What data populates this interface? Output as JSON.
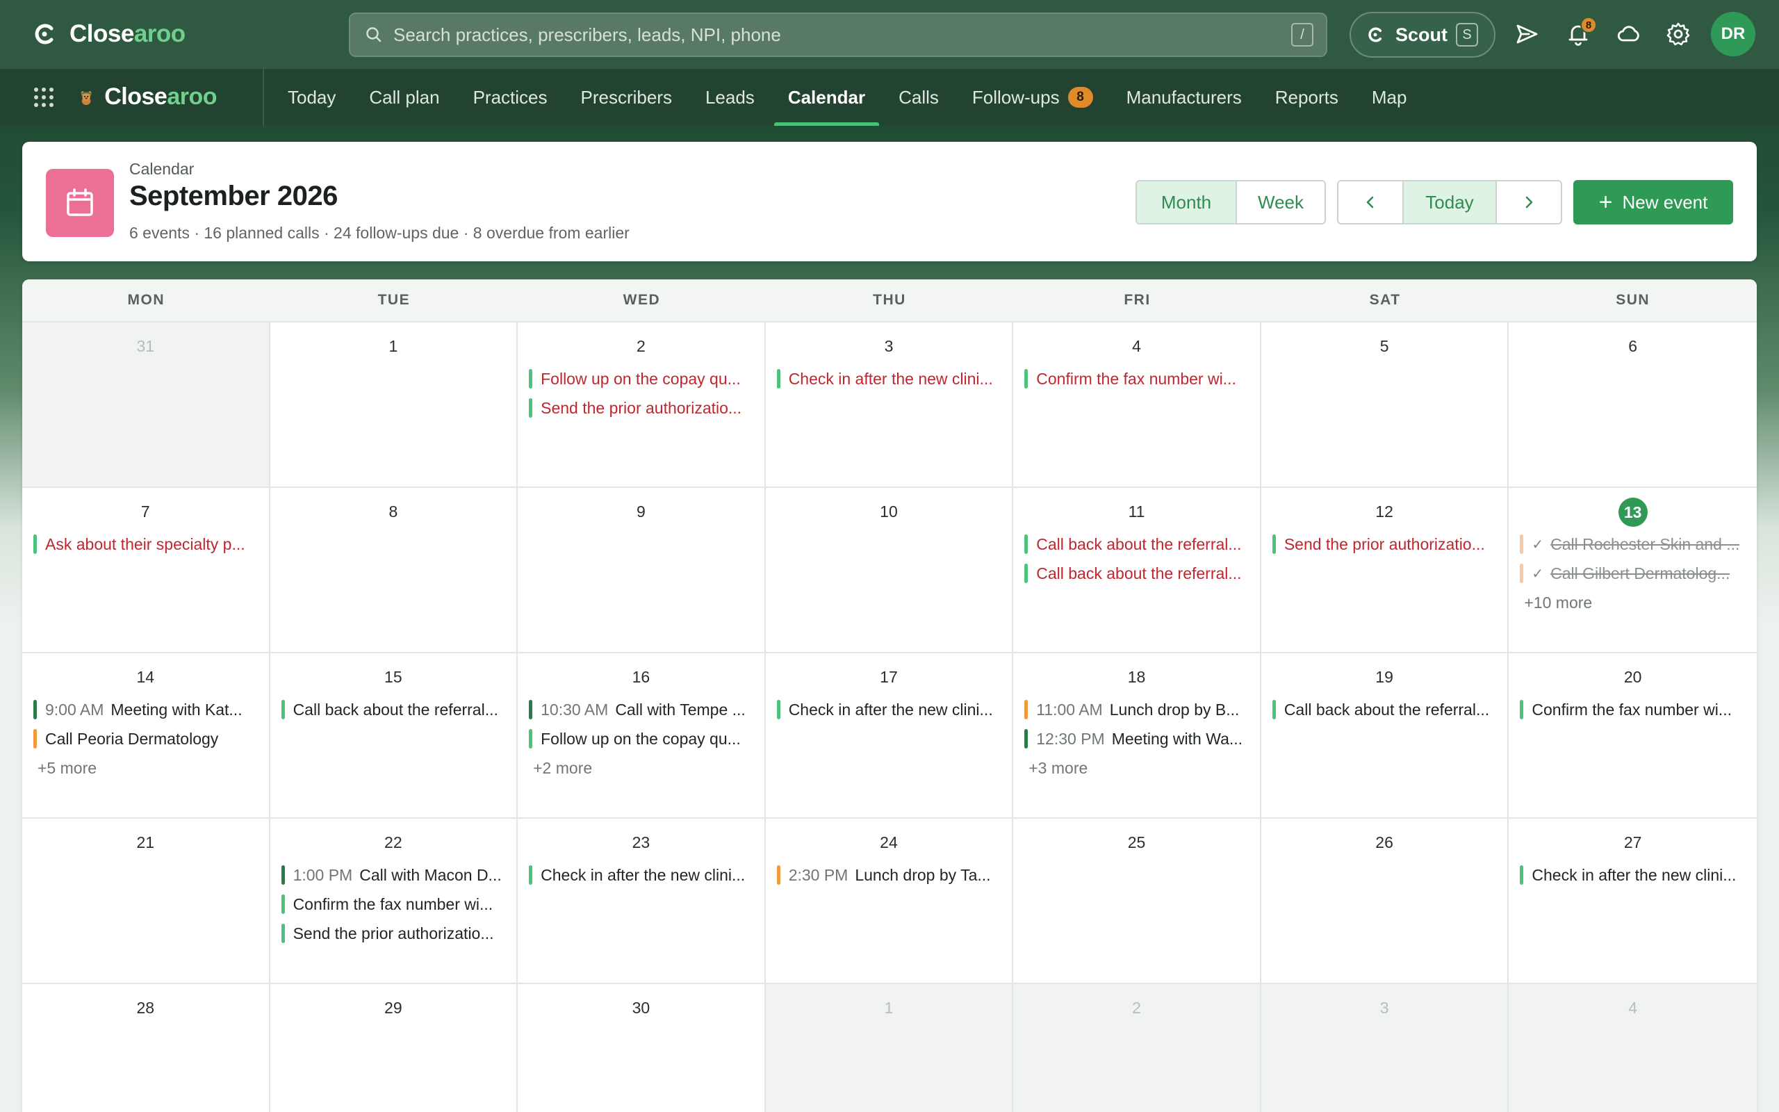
{
  "app": {
    "brand_prefix": "Close",
    "brand_suffix": "aroo"
  },
  "search": {
    "placeholder": "Search practices, prescribers, leads, NPI, phone",
    "shortcut": "/"
  },
  "scout": {
    "label": "Scout",
    "shortcut": "S"
  },
  "notifications": {
    "count": "8"
  },
  "user": {
    "initials": "DR"
  },
  "nav": {
    "items": [
      {
        "label": "Today"
      },
      {
        "label": "Call plan"
      },
      {
        "label": "Practices"
      },
      {
        "label": "Prescribers"
      },
      {
        "label": "Leads"
      },
      {
        "label": "Calendar",
        "active": true
      },
      {
        "label": "Calls"
      },
      {
        "label": "Follow-ups",
        "badge": "8"
      },
      {
        "label": "Manufacturers"
      },
      {
        "label": "Reports"
      },
      {
        "label": "Map"
      }
    ]
  },
  "header": {
    "eyebrow": "Calendar",
    "title": "September 2026",
    "summary": "6 events · 16 planned calls · 24 follow-ups due · 8 overdue from earlier",
    "view_month": "Month",
    "view_week": "Week",
    "prev": "‹",
    "today": "Today",
    "next": "›",
    "new_event": "New event"
  },
  "colors": {
    "accent": "#2e9a56",
    "overdue_text": "#c0262e",
    "followup_bar": "#4cc27c",
    "call_bar": "#f09a3c",
    "meeting_bar": "#2c7a4a",
    "done_bar": "#f6c9a6",
    "event_tile": "#ec6f96"
  },
  "calendar": {
    "weekdays": [
      "MON",
      "TUE",
      "WED",
      "THU",
      "FRI",
      "SAT",
      "SUN"
    ],
    "weeks": [
      [
        {
          "day": "31",
          "other": true,
          "events": []
        },
        {
          "day": "1",
          "events": []
        },
        {
          "day": "2",
          "events": [
            {
              "title": "Follow up on the copay qu...",
              "bar": "green",
              "style": "red"
            },
            {
              "title": "Send the prior authorizatio...",
              "bar": "green",
              "style": "red"
            }
          ]
        },
        {
          "day": "3",
          "events": [
            {
              "title": "Check in after the new clini...",
              "bar": "green",
              "style": "red"
            }
          ]
        },
        {
          "day": "4",
          "events": [
            {
              "title": "Confirm the fax number wi...",
              "bar": "green",
              "style": "red"
            }
          ]
        },
        {
          "day": "5",
          "events": []
        },
        {
          "day": "6",
          "events": []
        }
      ],
      [
        {
          "day": "7",
          "events": [
            {
              "title": "Ask about their specialty p...",
              "bar": "green",
              "style": "red"
            }
          ]
        },
        {
          "day": "8",
          "events": []
        },
        {
          "day": "9",
          "events": []
        },
        {
          "day": "10",
          "events": []
        },
        {
          "day": "11",
          "events": [
            {
              "title": "Call back about the referral...",
              "bar": "green",
              "style": "red"
            },
            {
              "title": "Call back about the referral...",
              "bar": "green",
              "style": "red"
            }
          ]
        },
        {
          "day": "12",
          "events": [
            {
              "title": "Send the prior authorizatio...",
              "bar": "green",
              "style": "red"
            }
          ]
        },
        {
          "day": "13",
          "today": true,
          "events": [
            {
              "title": "Call Rochester Skin and ...",
              "bar": "peach",
              "style": "done"
            },
            {
              "title": "Call Gilbert Dermatolog...",
              "bar": "peach",
              "style": "done"
            }
          ],
          "more": "+10 more"
        }
      ],
      [
        {
          "day": "14",
          "events": [
            {
              "time": "9:00 AM",
              "title": "Meeting with Kat...",
              "bar": "darkgreen",
              "style": "dark"
            },
            {
              "title": "Call Peoria Dermatology",
              "bar": "orange",
              "style": "dark"
            }
          ],
          "more": "+5 more"
        },
        {
          "day": "15",
          "events": [
            {
              "title": "Call back about the referral...",
              "bar": "green",
              "style": "dark"
            }
          ]
        },
        {
          "day": "16",
          "events": [
            {
              "time": "10:30 AM",
              "title": "Call with Tempe ...",
              "bar": "darkgreen",
              "style": "dark"
            },
            {
              "title": "Follow up on the copay qu...",
              "bar": "green",
              "style": "dark"
            }
          ],
          "more": "+2 more"
        },
        {
          "day": "17",
          "events": [
            {
              "title": "Check in after the new clini...",
              "bar": "green",
              "style": "dark"
            }
          ]
        },
        {
          "day": "18",
          "events": [
            {
              "time": "11:00 AM",
              "title": "Lunch drop by B...",
              "bar": "orange",
              "style": "dark"
            },
            {
              "time": "12:30 PM",
              "title": "Meeting with Wa...",
              "bar": "darkgreen",
              "style": "dark"
            }
          ],
          "more": "+3 more"
        },
        {
          "day": "19",
          "events": [
            {
              "title": "Call back about the referral...",
              "bar": "green",
              "style": "dark"
            }
          ]
        },
        {
          "day": "20",
          "events": [
            {
              "title": "Confirm the fax number wi...",
              "bar": "green",
              "style": "dark"
            }
          ]
        }
      ],
      [
        {
          "day": "21",
          "events": []
        },
        {
          "day": "22",
          "events": [
            {
              "time": "1:00 PM",
              "title": "Call with Macon D...",
              "bar": "darkgreen",
              "style": "dark"
            },
            {
              "title": "Confirm the fax number wi...",
              "bar": "green",
              "style": "dark"
            },
            {
              "title": "Send the prior authorizatio...",
              "bar": "green",
              "style": "dark"
            }
          ]
        },
        {
          "day": "23",
          "events": [
            {
              "title": "Check in after the new clini...",
              "bar": "green",
              "style": "dark"
            }
          ]
        },
        {
          "day": "24",
          "events": [
            {
              "time": "2:30 PM",
              "title": "Lunch drop by Ta...",
              "bar": "orange",
              "style": "dark"
            }
          ]
        },
        {
          "day": "25",
          "events": []
        },
        {
          "day": "26",
          "events": []
        },
        {
          "day": "27",
          "events": [
            {
              "title": "Check in after the new clini...",
              "bar": "green",
              "style": "dark"
            }
          ]
        }
      ],
      [
        {
          "day": "28",
          "events": []
        },
        {
          "day": "29",
          "events": []
        },
        {
          "day": "30",
          "events": []
        },
        {
          "day": "1",
          "other": true,
          "events": []
        },
        {
          "day": "2",
          "other": true,
          "events": []
        },
        {
          "day": "3",
          "other": true,
          "events": []
        },
        {
          "day": "4",
          "other": true,
          "events": []
        }
      ]
    ]
  }
}
